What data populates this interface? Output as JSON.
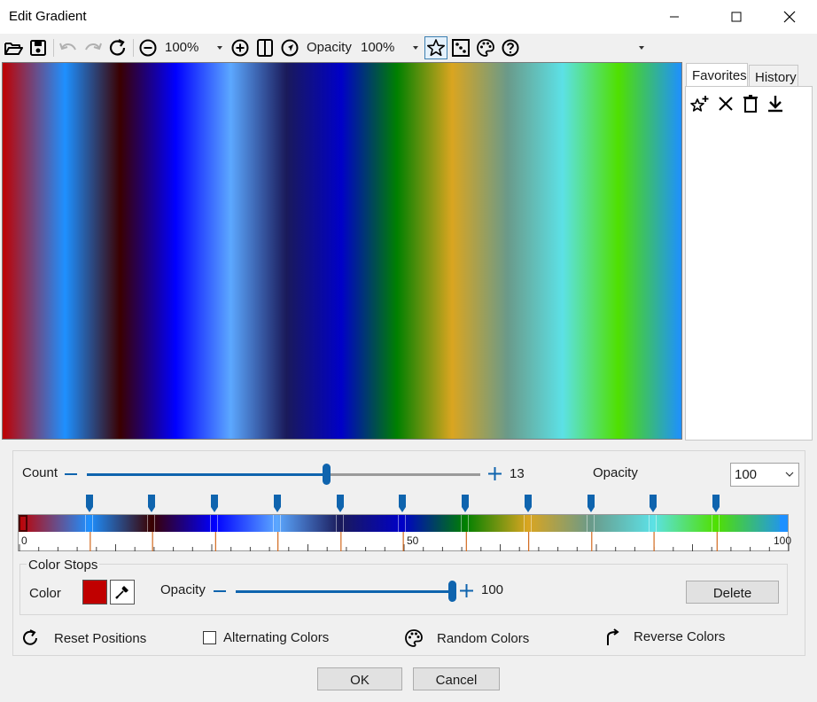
{
  "window": {
    "title": "Edit Gradient"
  },
  "toolbar": {
    "zoom_value": "100%",
    "opacity_label": "Opacity",
    "opacity_value": "100%"
  },
  "gradient_stops": [
    {
      "pos": 0,
      "color": "#c00000"
    },
    {
      "pos": 9.2,
      "color": "#1e90ff"
    },
    {
      "pos": 17.3,
      "color": "#3a0000"
    },
    {
      "pos": 25.5,
      "color": "#0000ff"
    },
    {
      "pos": 33.6,
      "color": "#5ca8ff"
    },
    {
      "pos": 41.8,
      "color": "#1a1a5a"
    },
    {
      "pos": 49.9,
      "color": "#0000c8"
    },
    {
      "pos": 58.1,
      "color": "#008000"
    },
    {
      "pos": 66.2,
      "color": "#daa520"
    },
    {
      "pos": 74.4,
      "color": "#6a9a8a"
    },
    {
      "pos": 82.5,
      "color": "#5ce1e6"
    },
    {
      "pos": 90.7,
      "color": "#50e000"
    },
    {
      "pos": 100,
      "color": "#1e90ff"
    }
  ],
  "side_panel": {
    "tabs": [
      "Favorites",
      "History"
    ],
    "active_tab": "Favorites"
  },
  "count": {
    "label": "Count",
    "value": "13",
    "slider_fraction": 0.61
  },
  "opacity": {
    "label": "Opacity",
    "value": "100"
  },
  "ruler": {
    "labels": [
      "0",
      "50",
      "100"
    ]
  },
  "color_stops": {
    "group_label": "Color Stops",
    "color_label": "Color",
    "selected_color": "#c00000",
    "opacity_label": "Opacity",
    "opacity_value": "100",
    "opacity_fraction": 1.0,
    "delete_label": "Delete"
  },
  "actions": {
    "reset": "Reset Positions",
    "alternating": "Alternating Colors",
    "random": "Random Colors",
    "reverse": "Reverse Colors"
  },
  "footer": {
    "ok": "OK",
    "cancel": "Cancel"
  },
  "icons": {
    "open": "folder-open-icon",
    "save": "save-icon",
    "undo": "undo-icon",
    "redo": "redo-icon",
    "refresh": "refresh-icon",
    "zoom_out": "zoom-out-icon",
    "zoom_in": "zoom-in-icon",
    "split": "split-view-icon",
    "navigate": "navigate-icon",
    "favorite": "star-icon",
    "random": "dice-icon",
    "palette": "palette-icon",
    "help": "help-icon"
  }
}
